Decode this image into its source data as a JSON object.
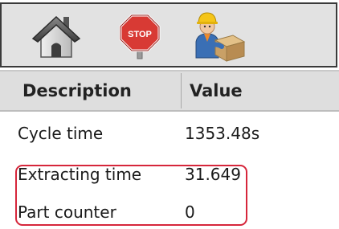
{
  "toolbar": {
    "buttons": [
      {
        "name": "home",
        "icon": "house-icon"
      },
      {
        "name": "stop",
        "icon": "stop-sign-icon",
        "label": "STOP"
      },
      {
        "name": "worker",
        "icon": "worker-with-box-icon"
      }
    ]
  },
  "table": {
    "headers": {
      "description": "Description",
      "value": "Value"
    },
    "rows": [
      {
        "description": "Cycle time",
        "value": "1353.48s"
      },
      {
        "description": "Extracting time",
        "value": "31.649"
      },
      {
        "description": "Part counter",
        "value": "0"
      }
    ]
  },
  "colors": {
    "toolbar_bg": "#e2e2e2",
    "header_bg": "#dedede",
    "highlight": "#d6263b",
    "stop_red": "#d83a34"
  }
}
